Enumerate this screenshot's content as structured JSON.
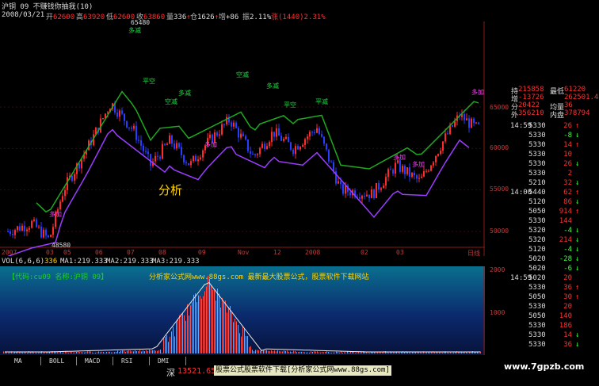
{
  "window": {
    "title": "沪铜 09 不赚钱你抽我(10)"
  },
  "infobar": {
    "date": "2008/03/21",
    "open_label": "开",
    "open": "62600",
    "high_label": "高",
    "high": "63920",
    "low_label": "低",
    "low": "62600",
    "close_label": "收",
    "close": "63860",
    "vol_label": "量",
    "vol": "336",
    "oi_label": "仓",
    "oi": "1626",
    "inc_label": "增",
    "inc": "+86",
    "amp_label": "振",
    "amp": "2.11%",
    "chg_label": "涨",
    "chg": "(1440)2.31%"
  },
  "main_chart": {
    "price_max_label": "65480",
    "price_min_label": "48580",
    "watermark": "分析",
    "y_ticks": [
      "65000",
      "60000",
      "55000",
      "50000"
    ],
    "x_ticks": [
      "2007",
      "03",
      "05",
      "06",
      "07",
      "08",
      "09",
      "Nov",
      "12",
      "2008",
      "02",
      "03"
    ],
    "axis_unit": "日线",
    "markers": [
      "多减",
      "多加",
      "平空",
      "空减",
      "多减",
      "多加",
      "空减",
      "多减",
      "平空",
      "平减",
      "多加",
      "多加",
      "多加"
    ]
  },
  "volume": {
    "header": {
      "label": "VOL(6,6,6)",
      "vol_value": "336",
      "ma1": "MA1:219.333",
      "ma2": "MA2:219.333",
      "ma3": "MA3:219.333"
    },
    "code_text": "【代码:cu09 名称:沪铜 09】",
    "ad_text": "分析家公式网www.88gs.com 最新最大股票公式，股票软件下载网站",
    "y_ticks": [
      "2000",
      "1000"
    ]
  },
  "tabs": [
    "MA",
    "BOLL",
    "MACD",
    "RSI",
    "DMI"
  ],
  "bottombar": {
    "market_label": "深",
    "market_value": "13521.65",
    "marquee": "股票公式股票软件下载[分析家公式网www.88gs.com]"
  },
  "right_panel": {
    "top": [
      {
        "label": "持",
        "value": "215858",
        "label2": "最低",
        "value2": "61220"
      },
      {
        "label": "增",
        "value": "-13726",
        "label2": "",
        "value2": "262501.44"
      },
      {
        "label": "分",
        "value": "20422",
        "label2": "均量",
        "value2": "36"
      },
      {
        "label": "外",
        "value": "356210",
        "label2": "内盘",
        "value2": "378794"
      }
    ],
    "ticks": [
      {
        "time": "14:59",
        "price": "5330",
        "vol": "26",
        "dir": "↑"
      },
      {
        "time": "",
        "price": "5330",
        "vol": "-8",
        "dir": "↓"
      },
      {
        "time": "",
        "price": "5330",
        "vol": "14",
        "dir": "↑"
      },
      {
        "time": "",
        "price": "5330",
        "vol": "10",
        "dir": ""
      },
      {
        "time": "",
        "price": "5330",
        "vol": "26",
        "dir": "↓"
      },
      {
        "time": "",
        "price": "5330",
        "vol": "2",
        "dir": ""
      },
      {
        "time": "",
        "price": "5210",
        "vol": "32",
        "dir": "↓"
      },
      {
        "time": "14:00",
        "price": "5440",
        "vol": "62",
        "dir": "↑"
      },
      {
        "time": "",
        "price": "5120",
        "vol": "86",
        "dir": "↓"
      },
      {
        "time": "",
        "price": "5050",
        "vol": "914",
        "dir": "↑"
      },
      {
        "time": "",
        "price": "5330",
        "vol": "144",
        "dir": ""
      },
      {
        "time": "",
        "price": "5320",
        "vol": "-4",
        "dir": "↓"
      },
      {
        "time": "",
        "price": "5320",
        "vol": "214",
        "dir": "↓"
      },
      {
        "time": "",
        "price": "5120",
        "vol": "-4",
        "dir": "↓"
      },
      {
        "time": "",
        "price": "5020",
        "vol": "-28",
        "dir": "↓"
      },
      {
        "time": "",
        "price": "5020",
        "vol": "-6",
        "dir": "↓"
      },
      {
        "time": "14:59",
        "price": "5020",
        "vol": "20",
        "dir": ""
      },
      {
        "time": "",
        "price": "5330",
        "vol": "36",
        "dir": "↑"
      },
      {
        "time": "",
        "price": "5050",
        "vol": "30",
        "dir": "↑"
      },
      {
        "time": "",
        "price": "5330",
        "vol": "20",
        "dir": ""
      },
      {
        "time": "",
        "price": "5050",
        "vol": "140",
        "dir": ""
      },
      {
        "time": "",
        "price": "5330",
        "vol": "186",
        "dir": ""
      },
      {
        "time": "",
        "price": "5330",
        "vol": "14",
        "dir": "↓"
      },
      {
        "time": "",
        "price": "5330",
        "vol": "36",
        "dir": "↓"
      }
    ]
  },
  "site_watermark": "www.7gpzb.com",
  "colors": {
    "up": "#ff2a2a",
    "down": "#2a3cff",
    "stop_up": "#9b3cff",
    "stop_down": "#1faa1f",
    "axis": "#8b1a1a",
    "text": "#c0c0c0"
  }
}
